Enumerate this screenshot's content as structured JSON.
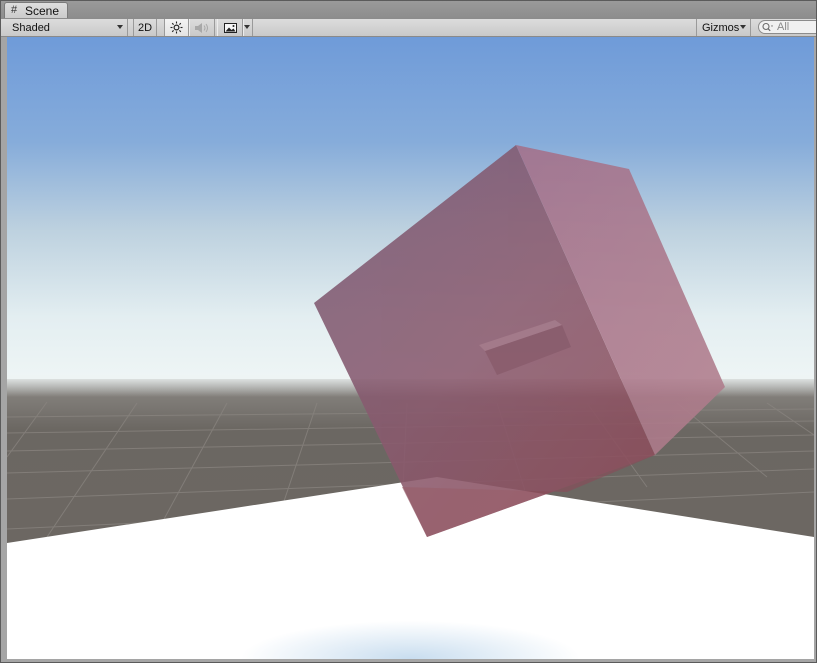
{
  "window": {
    "tab_title": "Scene",
    "tab_icon": "hash-grid-icon"
  },
  "toolbar": {
    "shading_mode": "Shaded",
    "mode_2d_label": "2D",
    "lighting_icon": "sun-icon",
    "audio_icon": "speaker-icon",
    "effects_icon": "image-icon",
    "gizmos_label": "Gizmos",
    "search_placeholder": "All"
  },
  "viewport": {
    "sky_top_color": "#6e9bd8",
    "sky_horizon_color": "#e8f4f8",
    "ground_color": "#6b6560",
    "floor_plane_color": "#ffffff",
    "cube_color": "#a05a6e",
    "selected_object": "cube"
  }
}
